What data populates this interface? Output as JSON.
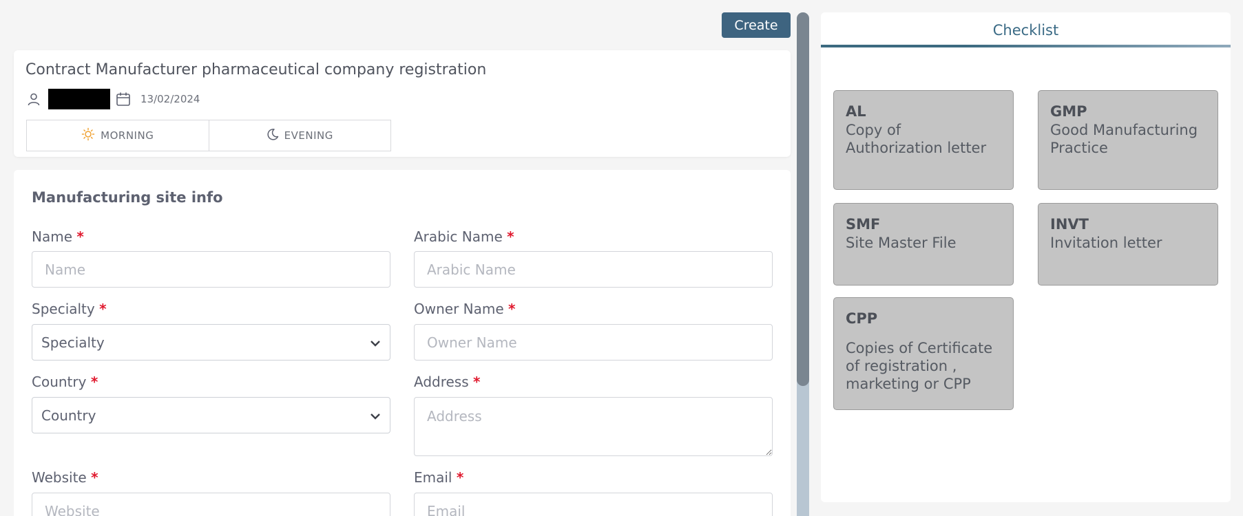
{
  "toolbar": {
    "create_label": "Create"
  },
  "header": {
    "title": "Contract Manufacturer pharmaceutical company registration",
    "date": "13/02/2024",
    "shifts": [
      {
        "label": "MORNING",
        "icon": "sun-icon"
      },
      {
        "label": "EVENING",
        "icon": "moon-icon"
      }
    ]
  },
  "form": {
    "section_title": "Manufacturing site info",
    "required_mark": "*",
    "name": {
      "label": "Name",
      "placeholder": "Name"
    },
    "arabic_name": {
      "label": "Arabic Name",
      "placeholder": "Arabic Name"
    },
    "specialty": {
      "label": "Specialty",
      "value": "Specialty"
    },
    "owner_name": {
      "label": "Owner Name",
      "placeholder": "Owner Name"
    },
    "country": {
      "label": "Country",
      "value": "Country"
    },
    "address": {
      "label": "Address",
      "placeholder": "Address"
    },
    "website": {
      "label": "Website",
      "placeholder": "Website"
    },
    "email": {
      "label": "Email",
      "placeholder": "Email"
    }
  },
  "checklist": {
    "title": "Checklist",
    "items": [
      {
        "code": "AL",
        "description": "Copy of Authorization letter"
      },
      {
        "code": "GMP",
        "description": "Good Manufacturing Practice"
      },
      {
        "code": "SMF",
        "description": "Site Master File"
      },
      {
        "code": "INVT",
        "description": "Invitation letter"
      },
      {
        "code": "CPP",
        "description": "Copies of Certificate of registration , marketing or CPP"
      }
    ]
  },
  "colors": {
    "primary": "#3e6480",
    "required": "#e0182d",
    "checklist_card": "#c4c4c4",
    "sun_icon": "#f0a232"
  }
}
